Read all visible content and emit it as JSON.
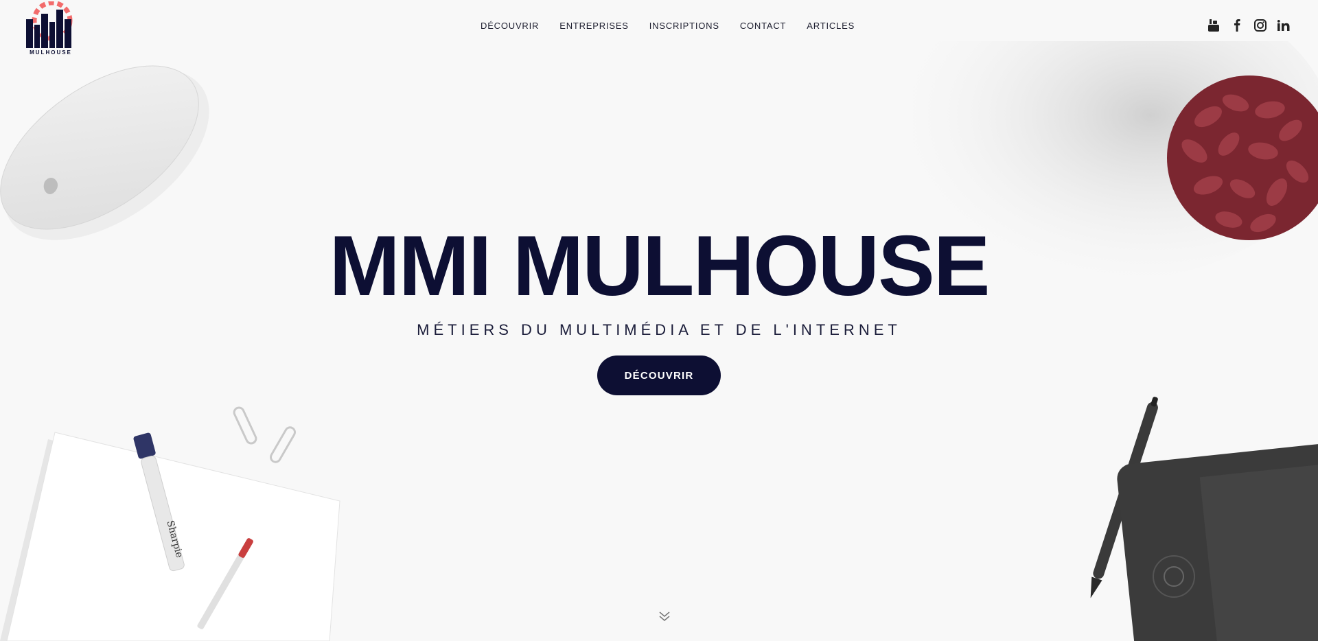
{
  "brand": {
    "logo_text": "MULHOUSE"
  },
  "nav": {
    "items": [
      {
        "label": "DÉCOUVRIR"
      },
      {
        "label": "ENTREPRISES"
      },
      {
        "label": "INSCRIPTIONS"
      },
      {
        "label": "CONTACT"
      },
      {
        "label": "ARTICLES"
      }
    ]
  },
  "social": [
    {
      "icon": "youtube-icon"
    },
    {
      "icon": "facebook-icon"
    },
    {
      "icon": "instagram-icon"
    },
    {
      "icon": "linkedin-icon"
    }
  ],
  "hero": {
    "title": "MMI MULHOUSE",
    "subtitle": "MÉTIERS DU MULTIMÉDIA ET DE L'INTERNET",
    "cta_label": "DÉCOUVRIR"
  },
  "colors": {
    "navy": "#0d0f33",
    "accent": "#f26b6b",
    "background": "#f8f8f8"
  }
}
